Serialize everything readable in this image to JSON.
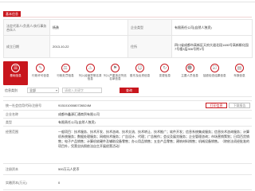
{
  "section_title": "基本信息",
  "summary": {
    "legal_rep_label": "法定代表人/负责人/执行事务合伙人",
    "legal_rep_value": "杨勇",
    "type_label": "企业类型",
    "type_value": "有限责任公司(自然人独资)",
    "date_label": "成立日期",
    "date_value": "2013-10-22",
    "address_label": "住所",
    "address_value": "四川省成都市高新区天府大道北段1480号高新孵化园7号楼3层306号附1号"
  },
  "tabs": [
    {
      "label": "基础信息",
      "icon": "license-icon",
      "active": true
    },
    {
      "label": "行政许可信息",
      "icon": "permit-icon",
      "active": false
    },
    {
      "label": "行政处罚信息",
      "icon": "penalty-icon",
      "active": false
    },
    {
      "label": "列入经营异常名录信息",
      "icon": "abnormal-icon",
      "active": false
    },
    {
      "label": "列入严重违法失信名单信息",
      "icon": "blacklist-icon",
      "active": false
    },
    {
      "label": "股东及出资信息",
      "icon": "shareholder-icon",
      "active": false
    },
    {
      "label": "变更信息",
      "icon": "change-icon",
      "active": false
    },
    {
      "label": "主要人员信息",
      "icon": "personnel-icon",
      "active": false
    },
    {
      "label": "抽查检查结果信息",
      "icon": "inspection-icon",
      "active": false
    },
    {
      "label": "年报信息",
      "icon": "annual-report-icon",
      "active": false
    }
  ],
  "filter": {
    "label": "信息类别",
    "select_value": "全部",
    "input_placeholder": "请输入关键字",
    "button_label": "查询"
  },
  "detail": {
    "credit_code_label": "统一社会信用代码/注册号",
    "credit_code_value": "91510100080726524M",
    "print_label": "打印信息",
    "download_label": "下载报告",
    "name_label": "企业名称",
    "name_value": "成都市鑫源汇通商贸有限公司",
    "type_label": "类型",
    "type_value": "有限责任公司(自然人独资)",
    "scope_label": "经营范围",
    "scope_value": "一般项目：技术服务、技术开发、技术咨询、技术交流、技术转让、技术推广；软件开发；信息系统集成服务；信息技术咨询服务；计算机系统服务；数据处理服务；网络技术服务；广告设计、代理；广告制作；会议及展览服务；企业管理咨询；市场营销策划；日用百货销售；电子产品销售；计算机软硬件及辅助设备零售；办公用品销售；五金产品零售；建筑材料销售；机械设备销售。（除依法须经批准的项目外，凭营业执照依法自主开展经营活动）",
    "capital_label": "注册资本",
    "capital_value": "500万元人民币",
    "paid_label": "实缴资本(万元)",
    "paid_value": "0"
  },
  "colors": {
    "accent": "#c8161d",
    "border": "#e6e6e6"
  }
}
